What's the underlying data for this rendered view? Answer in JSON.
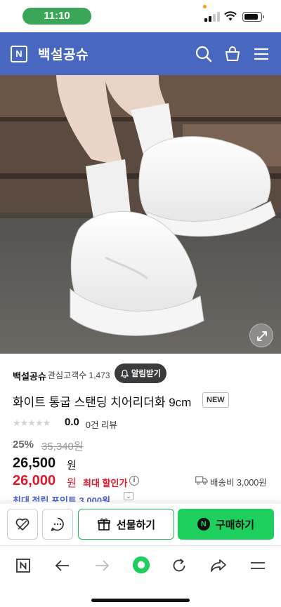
{
  "status_bar": {
    "time": "11:10"
  },
  "header": {
    "logo": "N",
    "store_name": "백설공슈"
  },
  "product_image": {
    "pager_count": 3,
    "pager_active": 0
  },
  "seller": {
    "name": "백설공슈",
    "interest": "관심고객수 1,473",
    "alarm_label": "알림받기"
  },
  "product": {
    "title": "화이트 통굽 스탠딩 치어리더화 9cm",
    "badge": "NEW",
    "stars": "★★★★★",
    "rating": "0.0",
    "reviews": "0건 리뷰",
    "discount_rate": "25%",
    "original_price": "35,340원",
    "sale_price": "26,500",
    "sale_unit": "원",
    "max_discount_price": "26,000",
    "max_discount_unit": "원",
    "max_discount_label": "최대 할인가",
    "info_icon": "i",
    "shipping": "배송비 3,000원",
    "max_points": "최대 적립 포인트 3,000원"
  },
  "actions": {
    "gift_label": "선물하기",
    "buy_label": "구매하기",
    "buy_logo": "N"
  },
  "colors": {
    "header": "#4867c0",
    "accent_green": "#1fcf5e",
    "price_red": "#e3172c",
    "points_blue": "#4a5fd0"
  }
}
